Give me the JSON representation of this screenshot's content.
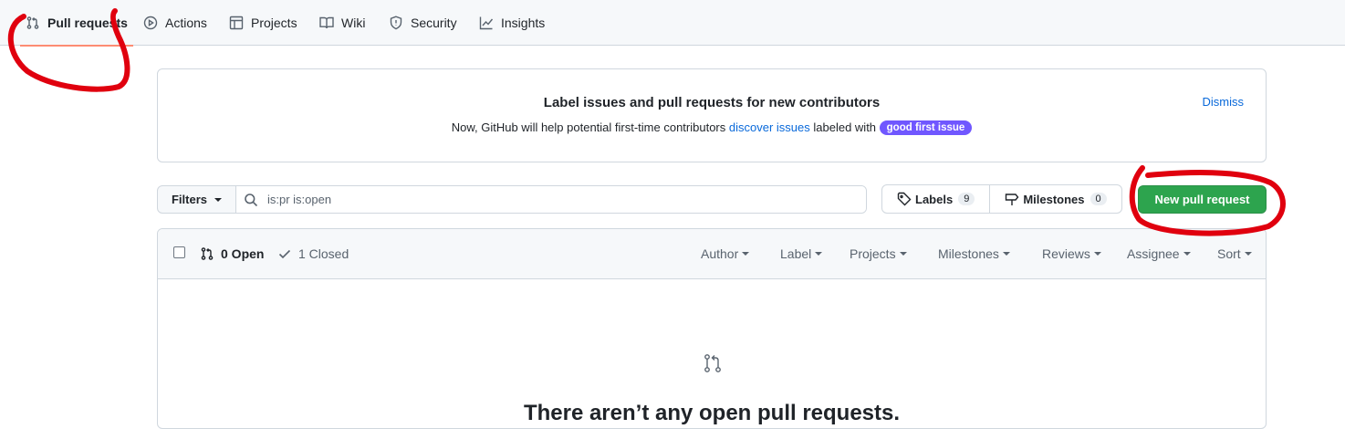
{
  "nav": {
    "items": [
      {
        "label": "Pull requests",
        "icon": "git-pull-request-icon",
        "selected": true
      },
      {
        "label": "Actions",
        "icon": "play-icon"
      },
      {
        "label": "Projects",
        "icon": "table-icon"
      },
      {
        "label": "Wiki",
        "icon": "book-icon"
      },
      {
        "label": "Security",
        "icon": "shield-icon"
      },
      {
        "label": "Insights",
        "icon": "graph-icon"
      }
    ]
  },
  "banner": {
    "title": "Label issues and pull requests for new contributors",
    "text_before": "Now, GitHub will help potential first-time contributors ",
    "link": "discover issues",
    "text_after": " labeled with ",
    "label_badge": "good first issue",
    "dismiss": "Dismiss"
  },
  "filters": {
    "button": "Filters",
    "search_value": "is:pr is:open"
  },
  "labels": {
    "label": "Labels",
    "count": "9"
  },
  "milestones": {
    "label": "Milestones",
    "count": "0"
  },
  "new_pr_button": "New pull request",
  "list_header": {
    "open": "0 Open",
    "closed": "1 Closed",
    "filters": [
      "Author",
      "Label",
      "Projects",
      "Milestones",
      "Reviews",
      "Assignee",
      "Sort"
    ]
  },
  "blankslate": {
    "title": "There aren’t any open pull requests."
  },
  "colors": {
    "annotation": "#e0000e",
    "primary_button": "#2da44e",
    "good_first_issue": "#7057ff",
    "link": "#0969da"
  }
}
